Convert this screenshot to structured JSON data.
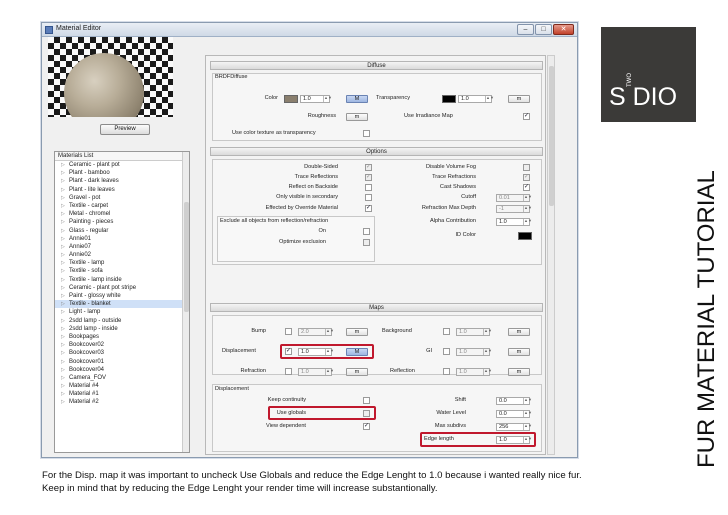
{
  "window": {
    "title": "Material Editor",
    "min": "–",
    "max": "□",
    "close": "✕"
  },
  "preview": {
    "button_label": "Preview"
  },
  "materials_list": {
    "header": "Materials List",
    "items": [
      "Ceramic - plant pot",
      "Plant - bamboo",
      "Plant - dark leaves",
      "Plant - lite leaves",
      "Gravel - pot",
      "Textile - carpet",
      "Metal - chromel",
      "Painting - pieces",
      "Glass - regular",
      "Annie01",
      "Annie07",
      "Annie02",
      "Textile - lamp",
      "Textile - sofa",
      "Textile - lamp inside",
      "Ceramic - plant pot stripe",
      "Paint - glossy white",
      "Textile - blanket",
      "Light - lamp",
      "2sdd lamp - outside",
      "2sdd lamp - inside",
      "Bookpages",
      "Bookcover02",
      "Bookcover03",
      "Bookcover01",
      "Bookcover04",
      "Camera_FOV",
      "Material #4",
      "Material #1",
      "Material #2"
    ],
    "selected": "Textile - blanket"
  },
  "diffuse": {
    "section": "Diffuse",
    "group_label": "BRDFDiffuse",
    "color_label": "Color",
    "color_value": "1.0",
    "color_swatch": "#8a7f6e",
    "color_map_btn": "M",
    "transparency_label": "Transparency",
    "transparency_value": "1.0",
    "transparency_swatch": "#000000",
    "transparency_map_btn": "m",
    "roughness_label": "Roughness",
    "roughness_map_btn": "m",
    "irradiance_label": "Use Irradiance Map",
    "irradiance_checked": "✓",
    "color_tex_label": "Use color texture as transparency"
  },
  "options": {
    "section": "Options",
    "double_sided": "Double-Sided",
    "trace_reflections": "Trace Reflections",
    "reflect_backside": "Reflect on Backside",
    "only_secondary": "Only visible in secondary",
    "effected_override": "Effected by Override Material",
    "disable_fog": "Disable Volume Fog",
    "trace_refractions": "Trace Refractions",
    "cast_shadows": "Cast Shadows",
    "cutoff": "Cutoff",
    "cutoff_value": "0.01",
    "refraction_depth": "Refraction Max Depth",
    "refraction_depth_value": "-1",
    "exclude_label": "Exclude all objects from reflection/refraction",
    "on_label": "On",
    "optimize_label": "Optimize exclusion",
    "alpha_label": "Alpha Contribution",
    "alpha_value": "1.0",
    "id_color_label": "ID Color",
    "id_color_swatch": "#000000",
    "check": "✓"
  },
  "maps": {
    "section": "Maps",
    "bump": "Bump",
    "bump_value": "2.0",
    "background": "Background",
    "background_value": "1.0",
    "displacement": "Displacement",
    "displacement_value": "1.0",
    "displacement_btn": "M",
    "gi": "GI",
    "gi_value": "1.0",
    "refraction": "Refraction",
    "refraction_value": "1.0",
    "reflection": "Reflection",
    "reflection_value": "1.0",
    "m": "m",
    "check": "✓"
  },
  "displacement": {
    "group_label": "Displacement",
    "keep_continuity": "Keep continuity",
    "use_globals": "Use globals",
    "view_dependent": "View dependent",
    "shift": "Shift",
    "shift_value": "0.0",
    "water_level": "Water Level",
    "water_level_value": "0.0",
    "max_subdivs": "Max subdivs",
    "max_subdivs_value": "256",
    "edge_length": "Edge length",
    "edge_length_value": "1.0",
    "check": "✓"
  },
  "brand": {
    "logo": "S DIO",
    "two": "TWO"
  },
  "side_title": "FUR MATERIAL TUTORIAL",
  "caption": "For the Disp. map it was important to uncheck Use Globals and reduce the Edge Lenght to 1.0 because i wanted really nice fur. Keep in mind that by reducing the Edge Lenght your render time will increase substantionally.",
  "colors": {
    "highlight": "#c0182d",
    "brand_bg": "#3b3a38",
    "selection": "#cfe0f7"
  },
  "icons": [
    "app-icon",
    "minimize-icon",
    "maximize-icon",
    "close-icon",
    "expand-arrow-icon",
    "spin-arrows-icon",
    "checkmark-icon"
  ]
}
